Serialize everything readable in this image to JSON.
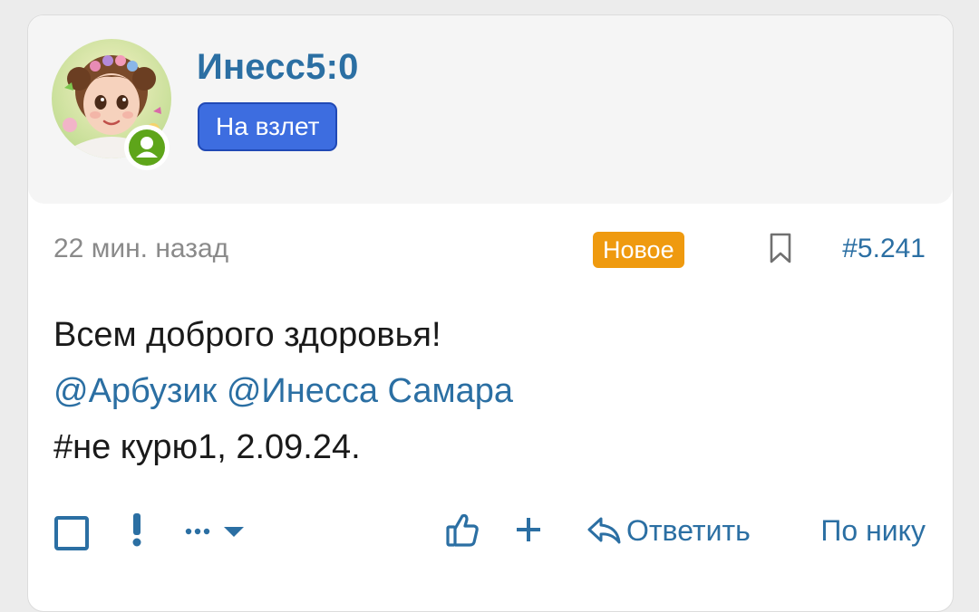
{
  "post": {
    "username": "Инесс5:0",
    "user_badge": "На взлет",
    "timestamp": "22 мин. назад",
    "new_label": "Новое",
    "post_number": "#5.241",
    "body": {
      "line1": "Всем доброго здоровья!",
      "mention1": "@Арбузик",
      "mention2": "@Инесса Самара",
      "line3": "#не курю1, 2.09.24."
    }
  },
  "footer": {
    "reply_label": "Ответить",
    "profile_label": "По нику"
  },
  "icons": {
    "select": "checkbox-icon",
    "report": "exclamation-icon",
    "more": "more-dots-icon",
    "like": "thumbs-up-icon",
    "plus": "plus-icon",
    "reply": "reply-arrow-icon",
    "bookmark": "bookmark-icon",
    "online": "user-online-icon"
  },
  "colors": {
    "link": "#2b6fa3",
    "badge": "#3d6de0",
    "new": "#ef9a0f",
    "online": "#5ea51a"
  }
}
